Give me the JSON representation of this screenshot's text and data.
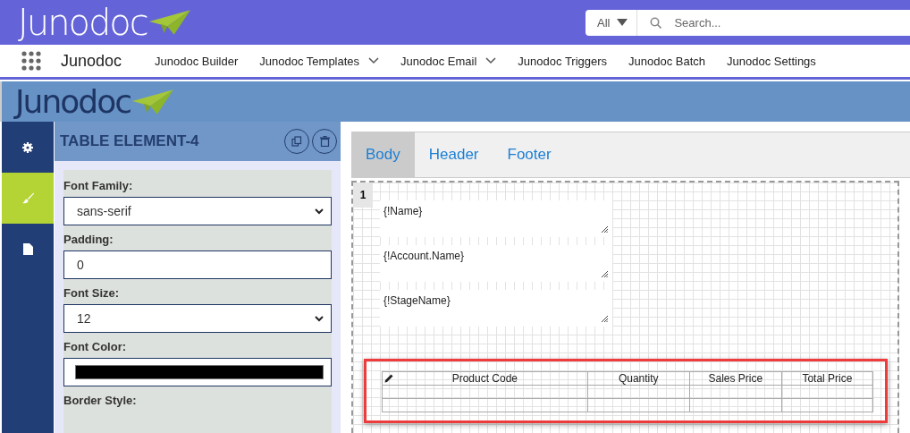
{
  "top_bar": {
    "logo": "Junodoc",
    "search": {
      "scope": "All",
      "placeholder": "Search..."
    }
  },
  "nav": {
    "app_name": "Junodoc",
    "items": [
      {
        "label": "Junodoc Builder",
        "has_menu": false
      },
      {
        "label": "Junodoc Templates",
        "has_menu": true
      },
      {
        "label": "Junodoc Email",
        "has_menu": true
      },
      {
        "label": "Junodoc Triggers",
        "has_menu": false
      },
      {
        "label": "Junodoc Batch",
        "has_menu": false
      },
      {
        "label": "Junodoc Settings",
        "has_menu": false
      }
    ]
  },
  "app_header": {
    "logo": "Junodoc"
  },
  "sidebar": {
    "items": [
      {
        "kind": "gear",
        "selected": false
      },
      {
        "kind": "brush",
        "selected": true
      },
      {
        "kind": "file",
        "selected": false
      }
    ]
  },
  "panel": {
    "title": "TABLE ELEMENT-4",
    "fields": [
      {
        "label": "Font Family:",
        "kind": "select",
        "value": "sans-serif"
      },
      {
        "label": "Padding:",
        "kind": "input",
        "value": "0"
      },
      {
        "label": "Font Size:",
        "kind": "select",
        "value": "12"
      },
      {
        "label": "Font Color:",
        "kind": "color",
        "color": "#000000"
      },
      {
        "label": "Border Style:"
      }
    ]
  },
  "canvas": {
    "tabs": [
      {
        "label": "Body",
        "selected": true
      },
      {
        "label": "Header",
        "selected": false
      },
      {
        "label": "Footer",
        "selected": false
      }
    ],
    "row_number": "1",
    "text_fields": [
      "{!Name}",
      "{!Account.Name}",
      "{!StageName}"
    ],
    "table": {
      "selected": true,
      "columns": [
        "Product Code",
        "Quantity",
        "Sales Price",
        "Total Price"
      ]
    }
  }
}
